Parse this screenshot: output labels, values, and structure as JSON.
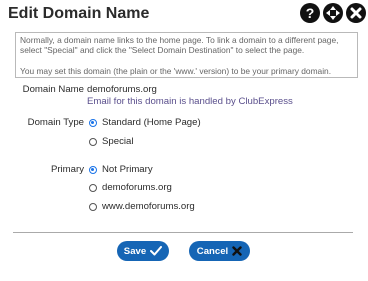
{
  "header": {
    "title": "Edit Domain Name"
  },
  "info": {
    "line1": "Normally, a domain name links to the home page. To link a domain to a different page, select \"Special\" and click the \"Select Domain Destination\" to select the page.",
    "line2": "You may set this domain (the plain or the 'www.' version) to be your primary domain."
  },
  "domain_name": {
    "label": "Domain Name",
    "value": "demoforums.org",
    "email_note": "Email for this domain is handled by ClubExpress"
  },
  "domain_type": {
    "label": "Domain Type",
    "options": [
      {
        "label": "Standard (Home Page)",
        "checked": true
      },
      {
        "label": "Special",
        "checked": false
      }
    ]
  },
  "primary": {
    "label": "Primary",
    "options": [
      {
        "label": "Not Primary",
        "checked": true
      },
      {
        "label": "demoforums.org",
        "checked": false
      },
      {
        "label": "www.demoforums.org",
        "checked": false
      }
    ]
  },
  "buttons": {
    "save_label": "Save",
    "cancel_label": "Cancel"
  },
  "colors": {
    "button_blue": "#1565b5",
    "note_purple": "#5a4f8c",
    "radio_blue": "#1a73e8"
  },
  "icons": [
    "help-icon",
    "move-icon",
    "close-icon",
    "checkmark-icon",
    "x-icon"
  ]
}
